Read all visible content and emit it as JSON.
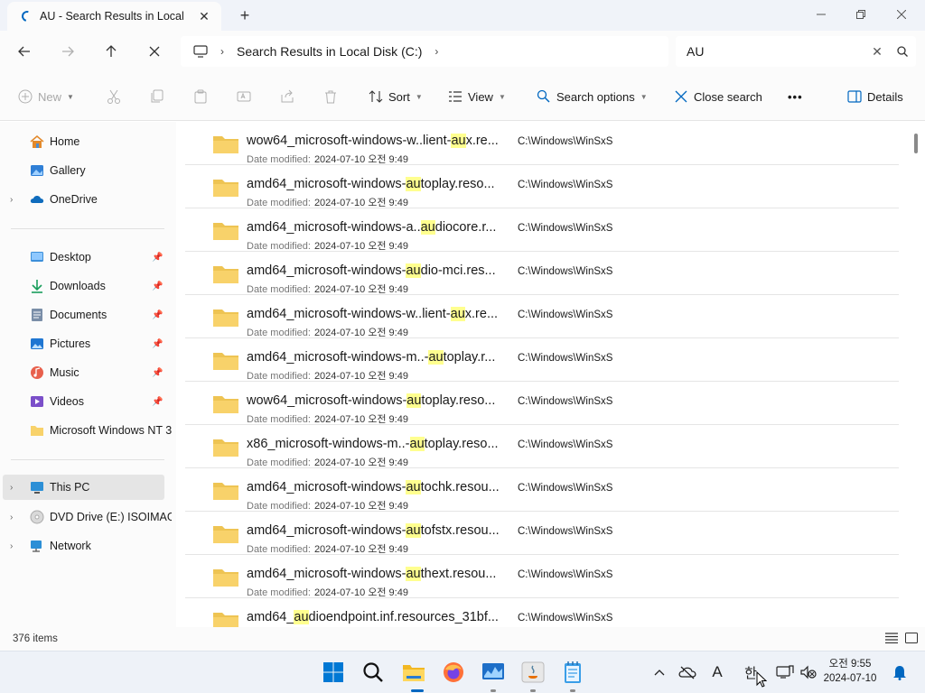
{
  "window": {
    "tab_title": "AU - Search Results in Local",
    "tab_close": "✕",
    "new_tab": "+"
  },
  "address": {
    "breadcrumb": "Search Results in Local Disk (C:)",
    "search_value": "AU"
  },
  "toolbar": {
    "new_label": "New",
    "sort_label": "Sort",
    "view_label": "View",
    "search_options_label": "Search options",
    "close_search_label": "Close search",
    "more_label": "•••",
    "details_label": "Details"
  },
  "sidebar": {
    "top": [
      {
        "label": "Home",
        "icon": "home-icon"
      },
      {
        "label": "Gallery",
        "icon": "gallery-icon"
      },
      {
        "label": "OneDrive",
        "icon": "cloud-icon"
      }
    ],
    "quick": [
      {
        "label": "Desktop",
        "icon": "desktop-icon"
      },
      {
        "label": "Downloads",
        "icon": "download-icon"
      },
      {
        "label": "Documents",
        "icon": "documents-icon"
      },
      {
        "label": "Pictures",
        "icon": "pictures-icon"
      },
      {
        "label": "Music",
        "icon": "music-icon"
      },
      {
        "label": "Videos",
        "icon": "videos-icon"
      },
      {
        "label": "Microsoft Windows NT 3",
        "icon": "folder-icon"
      }
    ],
    "devices": [
      {
        "label": "This PC",
        "icon": "pc-icon"
      },
      {
        "label": "DVD Drive (E:) ISOIMAGE",
        "icon": "dvd-icon"
      },
      {
        "label": "Network",
        "icon": "network-icon"
      }
    ]
  },
  "results": {
    "date_label": "Date modified:",
    "items": [
      {
        "pre": "wow64_microsoft-windows-w..lient-",
        "hl": "au",
        "post": "x.re...",
        "date": "2024-07-10 오전 9:49",
        "path": "C:\\Windows\\WinSxS"
      },
      {
        "pre": "amd64_microsoft-windows-",
        "hl": "au",
        "post": "toplay.reso...",
        "date": "2024-07-10 오전 9:49",
        "path": "C:\\Windows\\WinSxS"
      },
      {
        "pre": "amd64_microsoft-windows-a..",
        "hl": "au",
        "post": "diocore.r...",
        "date": "2024-07-10 오전 9:49",
        "path": "C:\\Windows\\WinSxS"
      },
      {
        "pre": "amd64_microsoft-windows-",
        "hl": "au",
        "post": "dio-mci.res...",
        "date": "2024-07-10 오전 9:49",
        "path": "C:\\Windows\\WinSxS"
      },
      {
        "pre": "amd64_microsoft-windows-w..lient-",
        "hl": "au",
        "post": "x.re...",
        "date": "2024-07-10 오전 9:49",
        "path": "C:\\Windows\\WinSxS"
      },
      {
        "pre": "amd64_microsoft-windows-m..-",
        "hl": "au",
        "post": "toplay.r...",
        "date": "2024-07-10 오전 9:49",
        "path": "C:\\Windows\\WinSxS"
      },
      {
        "pre": "wow64_microsoft-windows-",
        "hl": "au",
        "post": "toplay.reso...",
        "date": "2024-07-10 오전 9:49",
        "path": "C:\\Windows\\WinSxS"
      },
      {
        "pre": "x86_microsoft-windows-m..-",
        "hl": "au",
        "post": "toplay.reso...",
        "date": "2024-07-10 오전 9:49",
        "path": "C:\\Windows\\WinSxS"
      },
      {
        "pre": "amd64_microsoft-windows-",
        "hl": "au",
        "post": "tochk.resou...",
        "date": "2024-07-10 오전 9:49",
        "path": "C:\\Windows\\WinSxS"
      },
      {
        "pre": "amd64_microsoft-windows-",
        "hl": "au",
        "post": "tofstx.resou...",
        "date": "2024-07-10 오전 9:49",
        "path": "C:\\Windows\\WinSxS"
      },
      {
        "pre": "amd64_microsoft-windows-",
        "hl": "au",
        "post": "thext.resou...",
        "date": "2024-07-10 오전 9:49",
        "path": "C:\\Windows\\WinSxS"
      },
      {
        "pre": "amd64_",
        "hl": "au",
        "post": "dioendpoint.inf.resources_31bf...",
        "date": "",
        "path": "C:\\Windows\\WinSxS"
      }
    ]
  },
  "status": {
    "item_count": "376 items"
  },
  "taskbar": {
    "time": "오전 9:55",
    "date": "2024-07-10",
    "ime_a": "A",
    "ime_han": "한"
  },
  "colors": {
    "accent": "#0067c0",
    "highlight": "#ffff8f",
    "folder": "#f8d26a"
  }
}
